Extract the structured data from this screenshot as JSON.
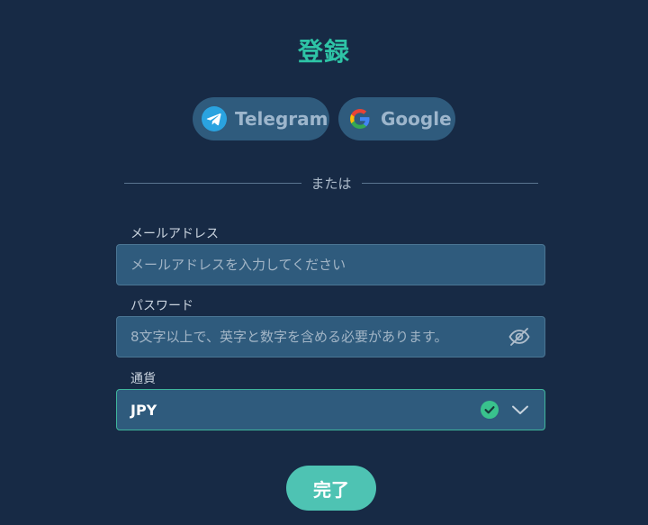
{
  "page": {
    "title": "登録",
    "colors": {
      "background": "#172a45",
      "accent": "#2ec4a6",
      "field": "#2f5b7d",
      "button": "#4ec3b3"
    }
  },
  "social": {
    "telegram": {
      "label": "Telegram",
      "icon": "telegram-icon"
    },
    "google": {
      "label": "Google",
      "icon": "google-icon"
    }
  },
  "divider": {
    "text": "または"
  },
  "form": {
    "email": {
      "label": "メールアドレス",
      "value": "",
      "placeholder": "メールアドレスを入力してください"
    },
    "password": {
      "label": "パスワード",
      "value": "",
      "placeholder": "8文字以上で、英字と数字を含める必要があります。",
      "toggle_icon": "eye-off-icon"
    },
    "currency": {
      "label": "通貨",
      "selected": "JPY",
      "status_icon": "check-circle-icon",
      "dropdown_icon": "chevron-down-icon"
    },
    "submit_label": "完了"
  }
}
